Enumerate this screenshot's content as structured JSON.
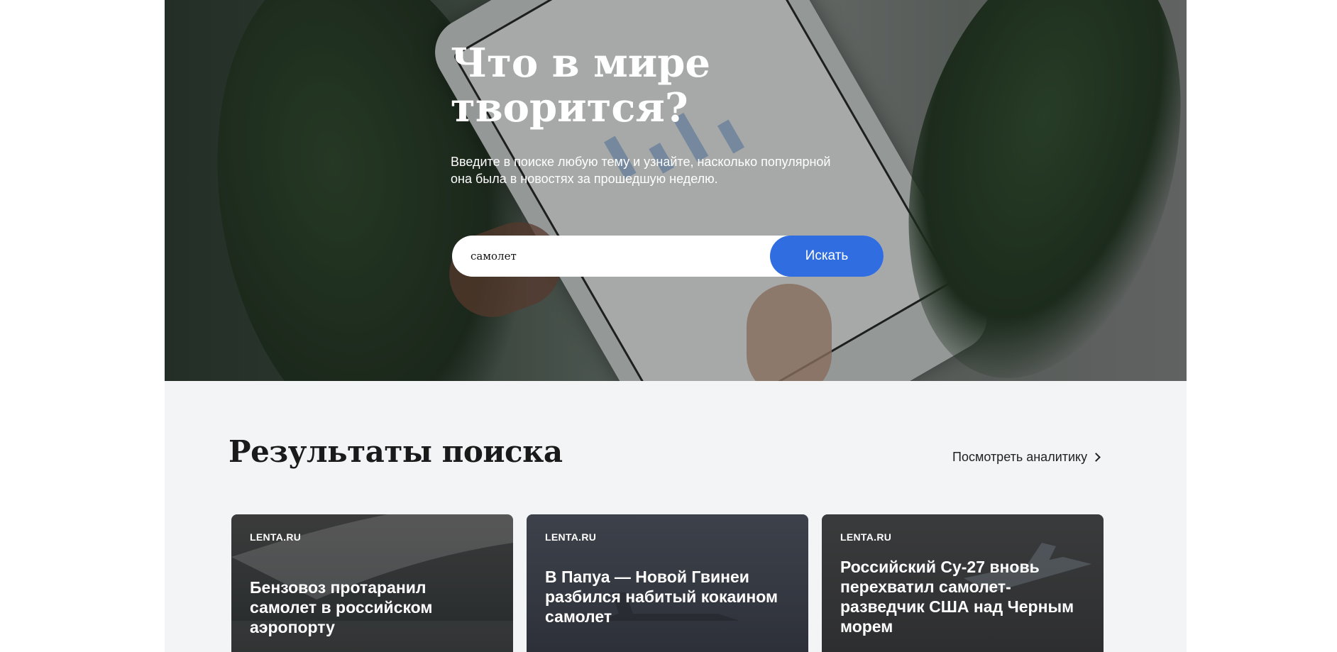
{
  "hero": {
    "title": "Что в мире творится?",
    "subtitle": "Введите в поиске любую тему и узнайте, насколько популярной она была в новостях за прошедшую неделю.",
    "search": {
      "value": "самолет",
      "button_label": "Искать"
    }
  },
  "results": {
    "title": "Результаты поиска",
    "analytics_link": "Посмотреть аналитику",
    "cards": [
      {
        "source": "LENTA.RU",
        "title": "Бензовоз протаранил самолет в российском аэропорту"
      },
      {
        "source": "LENTA.RU",
        "title": "В Папуа — Новой Гвинеи разбился набитый кокаином самолет"
      },
      {
        "source": "LENTA.RU",
        "title": "Российский Су-27 вновь перехватил самолет-разведчик США над Черным морем"
      }
    ]
  },
  "colors": {
    "accent": "#2f6de1",
    "section_bg": "#f3f4f6"
  }
}
